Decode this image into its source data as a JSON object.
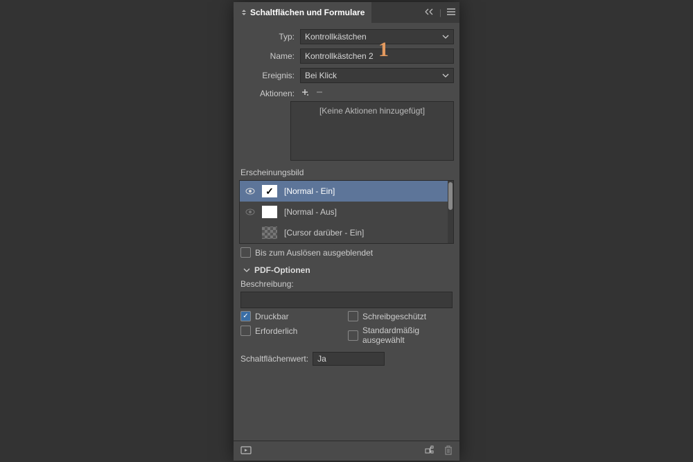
{
  "panel": {
    "title": "Schaltflächen und Formulare"
  },
  "fields": {
    "type_label": "Typ:",
    "type_value": "Kontrollkästchen",
    "name_label": "Name:",
    "name_value": "Kontrollkästchen 2",
    "event_label": "Ereignis:",
    "event_value": "Bei Klick",
    "actions_label": "Aktionen:",
    "actions_empty": "[Keine Aktionen hinzugefügt]"
  },
  "appearance": {
    "label": "Erscheinungsbild",
    "states": [
      {
        "name": "[Normal - Ein]"
      },
      {
        "name": "[Normal - Aus]"
      },
      {
        "name": "[Cursor darüber - Ein]"
      }
    ],
    "hidden_until": "Bis zum Auslösen ausgeblendet"
  },
  "pdf": {
    "section": "PDF-Optionen",
    "desc_label": "Beschreibung:",
    "desc_value": "",
    "printable": "Druckbar",
    "readonly": "Schreibgeschützt",
    "required": "Erforderlich",
    "default_selected": "Standardmäßig ausgewählt",
    "btnvalue_label": "Schaltflächenwert:",
    "btnvalue": "Ja"
  },
  "callout": "1"
}
